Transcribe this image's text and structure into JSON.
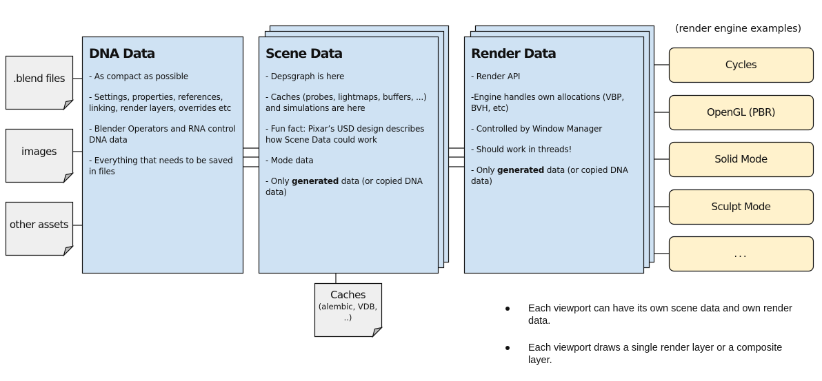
{
  "colors": {
    "panel_fill": "#cfe2f3",
    "doc_fill": "#efefef",
    "engine_fill": "#fff2cc",
    "stroke": "#111111"
  },
  "inputs": [
    {
      "label": ".blend files",
      "icon": "document-icon"
    },
    {
      "label": "images",
      "icon": "document-icon"
    },
    {
      "label": "other assets",
      "icon": "document-icon"
    }
  ],
  "dna": {
    "title": "DNA Data",
    "items": [
      "- As compact as possible",
      "- Settings, properties, references, linking, render layers, overrides etc",
      "- Blender Operators and RNA control DNA data",
      "- Everything that needs to be saved in files"
    ]
  },
  "scene": {
    "title": "Scene Data",
    "items": [
      "- Depsgraph is here",
      "- Caches (probes, lightmaps, buffers, ...) and simulations are here",
      "- Fun fact: Pixar’s USD design describes how Scene Data could work",
      "- Mode data"
    ],
    "last_prefix": "-  Only ",
    "last_bold": "generated",
    "last_suffix": " data (or copied DNA data)"
  },
  "render": {
    "title": "Render Data",
    "items": [
      "- Render API",
      "-Engine handles own allocations (VBP, BVH, etc)",
      "- Controlled by Window Manager",
      "- Should work in threads!"
    ],
    "last_prefix": "-  Only ",
    "last_bold": "generated",
    "last_suffix": " data (or copied DNA data)"
  },
  "engines": {
    "caption": "(render engine examples)",
    "items": [
      "Cycles",
      "OpenGL (PBR)",
      "Solid Mode",
      "Sculpt Mode",
      "..."
    ]
  },
  "caches": {
    "title": "Caches",
    "subtitle": "(alembic, VDB, ..)"
  },
  "notes": [
    "Each viewport can have its own scene data and own render data.",
    "Each viewport draws a single render layer or a composite layer."
  ]
}
